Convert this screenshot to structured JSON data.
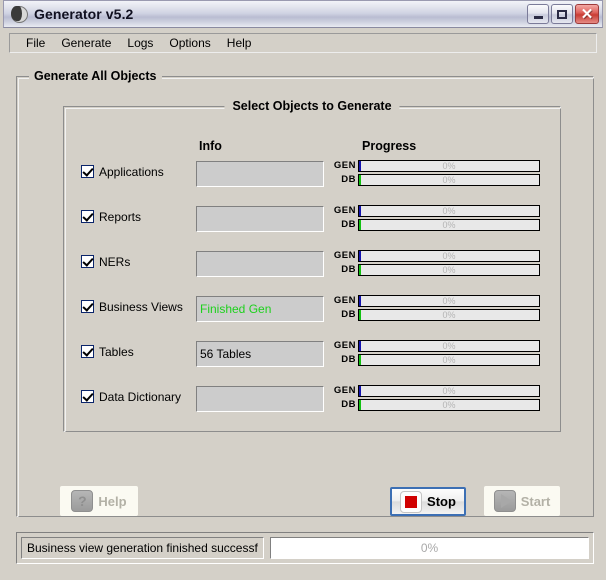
{
  "window": {
    "title": "Generator v5.2",
    "icon": "moon-app-icon",
    "controls": {
      "minimize": "minimize-button",
      "maximize": "maximize-button",
      "close": "close-button",
      "close_glyph": "✕"
    }
  },
  "menubar": {
    "items": [
      {
        "label": "File"
      },
      {
        "label": "Generate"
      },
      {
        "label": "Logs"
      },
      {
        "label": "Options"
      },
      {
        "label": "Help"
      }
    ]
  },
  "outer_group": {
    "title": "Generate All Objects"
  },
  "inner_group": {
    "title": "Select Objects to Generate",
    "columns": {
      "info": "Info",
      "progress": "Progress"
    },
    "progress_labels": {
      "gen": "GEN",
      "db": "DB"
    },
    "rows": [
      {
        "label": "Applications",
        "checked": true,
        "info": "",
        "gen_percent": "0%",
        "db_percent": "0%"
      },
      {
        "label": "Reports",
        "checked": true,
        "info": "",
        "gen_percent": "0%",
        "db_percent": "0%"
      },
      {
        "label": "NERs",
        "checked": true,
        "info": "",
        "gen_percent": "0%",
        "db_percent": "0%"
      },
      {
        "label": "Business Views",
        "checked": true,
        "info": "Finished Gen",
        "gen_percent": "0%",
        "db_percent": "0%"
      },
      {
        "label": "Tables",
        "checked": true,
        "info": "56 Tables",
        "gen_percent": "0%",
        "db_percent": "0%"
      },
      {
        "label": "Data Dictionary",
        "checked": true,
        "info": "",
        "gen_percent": "0%",
        "db_percent": "0%"
      }
    ]
  },
  "buttons": {
    "help": {
      "label": "Help",
      "icon": "question-mark-icon",
      "glyph": "?",
      "enabled": false
    },
    "stop": {
      "label": "Stop",
      "icon": "stop-square-icon",
      "enabled": true
    },
    "start": {
      "label": "Start",
      "icon": "play-triangle-icon",
      "enabled": false
    }
  },
  "statusbar": {
    "message": "Business view generation finished successf",
    "progress_percent": "0%"
  },
  "colors": {
    "gen_bar": "#1414b0",
    "db_bar": "#11c011",
    "info_success_text": "#1dd11d",
    "stop_icon": "#d00000",
    "focus_border": "#3c6fb4"
  }
}
